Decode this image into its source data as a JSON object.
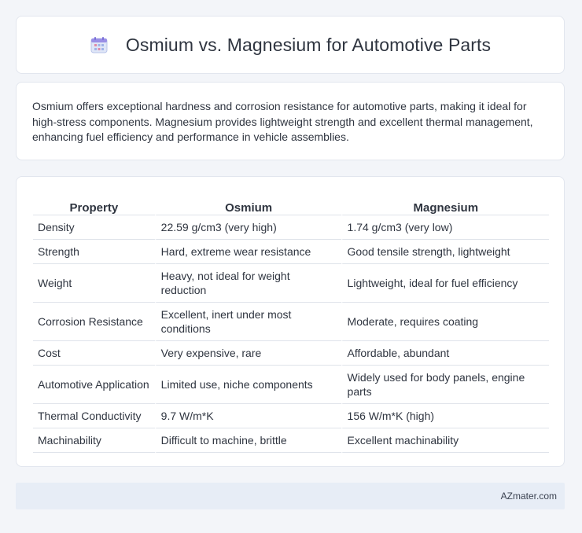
{
  "header": {
    "title": "Osmium vs. Magnesium for Automotive Parts",
    "icon": "calendar-icon"
  },
  "summary": {
    "text": "Osmium offers exceptional hardness and corrosion resistance for automotive parts, making it ideal for high-stress components. Magnesium provides lightweight strength and excellent thermal management, enhancing fuel efficiency and performance in vehicle assemblies."
  },
  "table": {
    "headers": [
      "Property",
      "Osmium",
      "Magnesium"
    ],
    "rows": [
      [
        "Density",
        "22.59 g/cm3 (very high)",
        "1.74 g/cm3 (very low)"
      ],
      [
        "Strength",
        "Hard, extreme wear resistance",
        "Good tensile strength, lightweight"
      ],
      [
        "Weight",
        "Heavy, not ideal for weight reduction",
        "Lightweight, ideal for fuel efficiency"
      ],
      [
        "Corrosion Resistance",
        "Excellent, inert under most conditions",
        "Moderate, requires coating"
      ],
      [
        "Cost",
        "Very expensive, rare",
        "Affordable, abundant"
      ],
      [
        "Automotive Application",
        "Limited use, niche components",
        "Widely used for body panels, engine parts"
      ],
      [
        "Thermal Conductivity",
        "9.7 W/m*K",
        "156 W/m*K (high)"
      ],
      [
        "Machinability",
        "Difficult to machine, brittle",
        "Excellent machinability"
      ]
    ]
  },
  "footer": {
    "site": "AZmater.com"
  },
  "colors": {
    "page_background": "#f3f5f9",
    "card_background": "#ffffff",
    "footer_background": "#e7edf6",
    "icon_accent": "#8a7ee0"
  }
}
